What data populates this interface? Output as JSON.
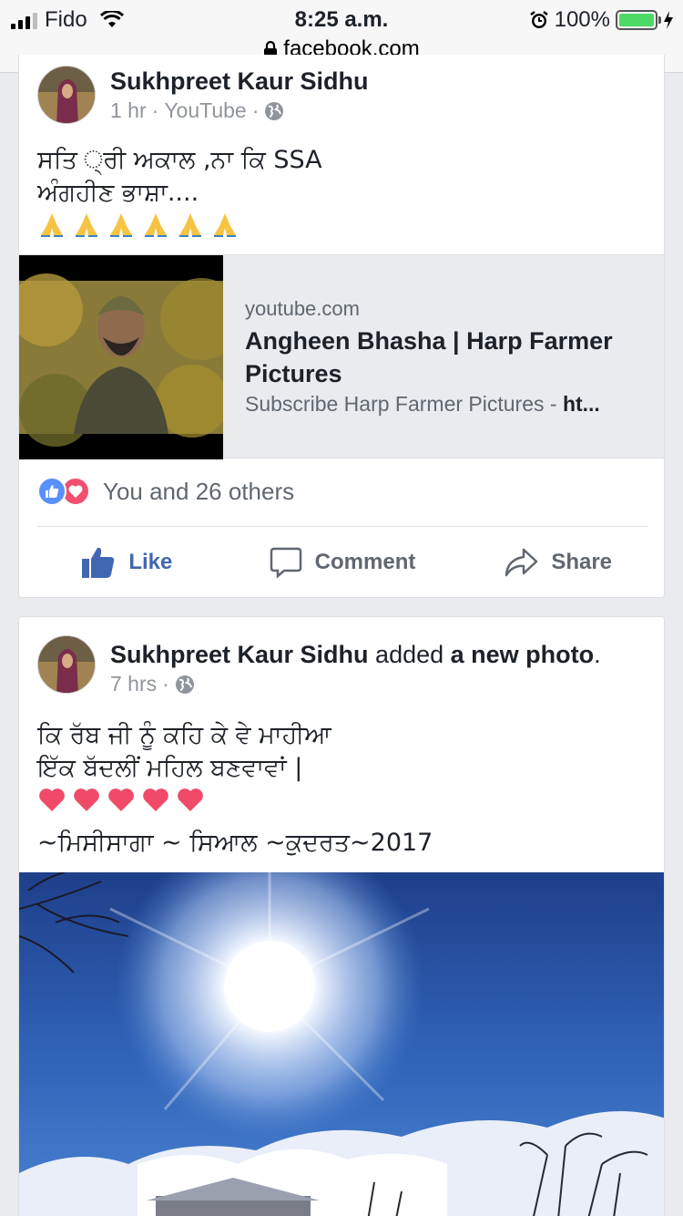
{
  "status_bar": {
    "carrier": "Fido",
    "time": "8:25 a.m.",
    "battery": "100%",
    "url": "facebook.com"
  },
  "post1": {
    "author": "Sukhpreet Kaur Sidhu",
    "time": "1 hr",
    "source": "YouTube",
    "text_line1": "ਸਤਿ ੍ਰੀ ਅਕਾਲ ,ਨਾ ਕਿ SSA",
    "text_line2": "ਅੰਗਹੀਣ ਭਾਸ਼ਾ....",
    "emoji": "🙏🙏🙏🙏🙏🙏",
    "link": {
      "domain": "youtube.com",
      "title": "Angheen Bhasha | Harp Farmer Pictures",
      "desc_prefix": "Subscribe Harp Farmer Pictures - ",
      "desc_bold": "ht..."
    },
    "reactions_text": "You and 26 others",
    "actions": {
      "like": "Like",
      "comment": "Comment",
      "share": "Share"
    }
  },
  "post2": {
    "author": "Sukhpreet Kaur Sidhu",
    "action_text": " added ",
    "action_bold": "a new photo",
    "action_end": ".",
    "time": "7 hrs",
    "text_line1": "ਕਿ ਰੱਬ ਜੀ ਨੂੰ ਕਹਿ ਕੇ ਵੇ ਮਾਹੀਆ",
    "text_line2": "ਇੱਕ ਬੱਦਲੀਂ ਮਹਿਲ ਬਣਵਾਵਾਂ |",
    "hearts": "❤️❤️❤️❤️❤️",
    "text_line3": "~ਮਿਸੀਸਾਗਾ ~ ਸਿਆਲ ~ਕੁਦਰਤ~2017"
  },
  "colors": {
    "facebook_blue": "#4267b2",
    "like_blue": "#5890ff",
    "love_red": "#f0506e",
    "battery_green": "#4cd964"
  }
}
